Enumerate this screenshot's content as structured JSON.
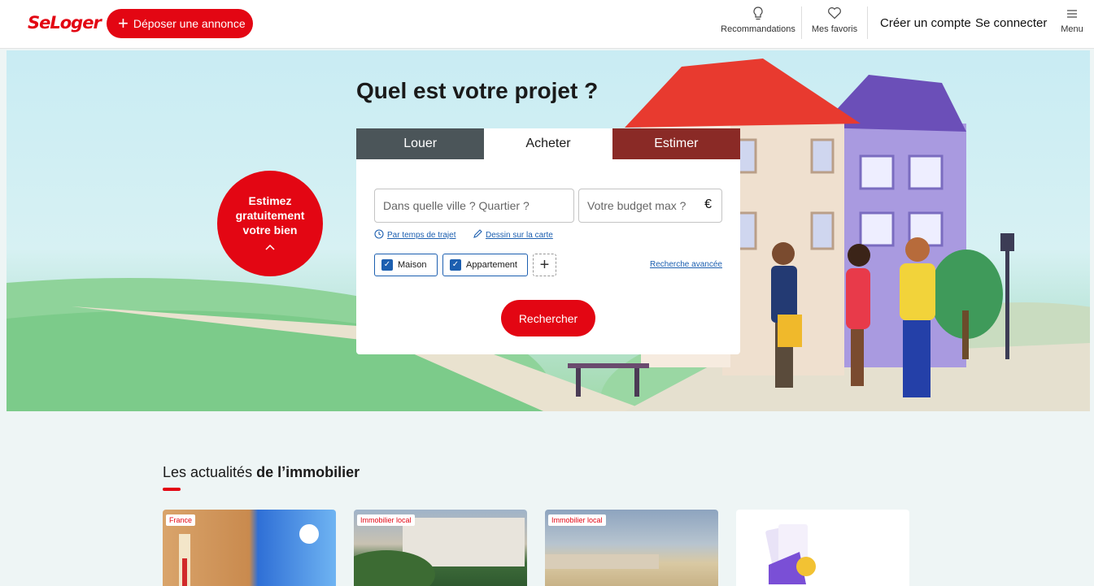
{
  "header": {
    "logo": "SeLoger",
    "post_button": "Déposer une annonce",
    "recommendations": "Recommandations",
    "favorites": "Mes favoris",
    "create_account": "Créer un compte",
    "login": "Se connecter",
    "menu": "Menu"
  },
  "hero": {
    "title": "Quel est votre projet ?",
    "estimate_badge": [
      "Estimez",
      "gratuitement",
      "votre bien"
    ],
    "tabs": [
      {
        "label": "Louer",
        "active": false
      },
      {
        "label": "Acheter",
        "active": true
      },
      {
        "label": "Estimer",
        "active": false
      }
    ]
  },
  "search": {
    "city_placeholder": "Dans quelle ville ? Quartier ?",
    "budget_placeholder": "Votre budget max ?",
    "currency": "€",
    "travel_time_link": "Par temps de trajet",
    "draw_map_link": "Dessin sur la carte",
    "types": [
      {
        "label": "Maison",
        "checked": true
      },
      {
        "label": "Appartement",
        "checked": true
      }
    ],
    "advanced_link": "Recherche avancée",
    "search_button": "Rechercher"
  },
  "news": {
    "title_regular": "Les actualités ",
    "title_bold": "de l’immobilier",
    "cards": [
      {
        "tag": "France"
      },
      {
        "tag": "Immobilier local"
      },
      {
        "tag": "Immobilier local"
      },
      {
        "tag": ""
      }
    ]
  },
  "colors": {
    "brand_red": "#e30613",
    "link_blue": "#1c5fb0",
    "tab_dark": "#4b5559"
  }
}
